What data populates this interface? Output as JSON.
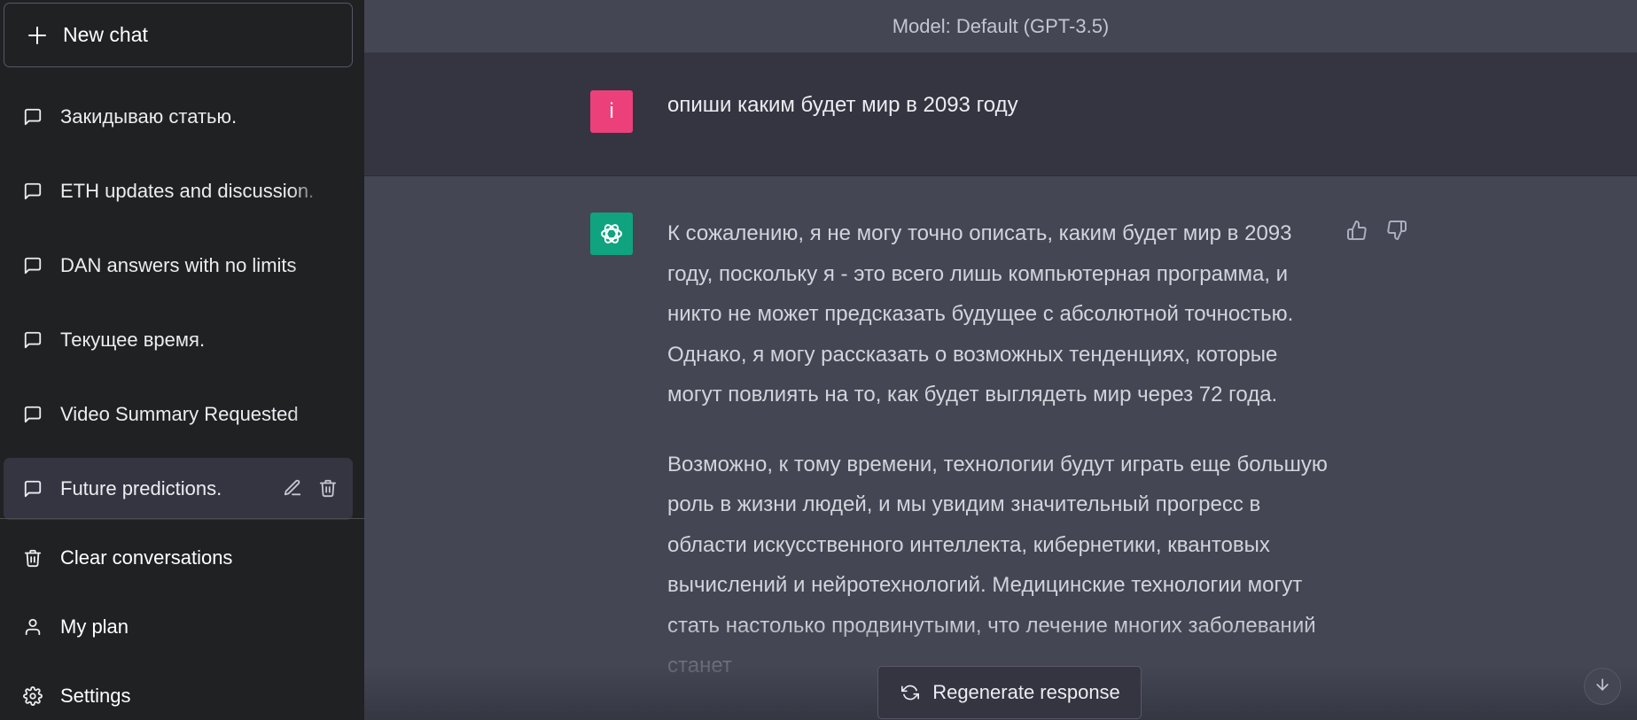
{
  "sidebar": {
    "new_chat_label": "New chat",
    "chats": [
      {
        "title": "Закидываю статью."
      },
      {
        "title": "ETH updates and discussion."
      },
      {
        "title": "DAN answers with no limits"
      },
      {
        "title": "Текущее время."
      },
      {
        "title": "Video Summary Requested"
      },
      {
        "title": "Future predictions."
      }
    ],
    "active_index": 5,
    "bottom": {
      "clear": "Clear conversations",
      "plan": "My plan",
      "settings": "Settings"
    }
  },
  "header": {
    "model_label": "Model: Default (GPT-3.5)"
  },
  "conversation": {
    "user_initial": "i",
    "user_message": "опиши каким будет мир в 2093 году",
    "assistant_paragraphs": [
      "К сожалению, я не могу точно описать, каким будет мир в 2093 году, поскольку я - это всего лишь компьютерная программа, и никто не может предсказать будущее с абсолютной точностью. Однако, я могу рассказать о возможных тенденциях, которые могут повлиять на то, как будет выглядеть мир через 72 года.",
      "Возможно, к тому времени, технологии будут играть еще большую роль в жизни людей, и мы увидим значительный прогресс в области искусственного интеллекта, кибернетики, квантовых вычислений и нейротехнологий. Медицинские технологии могут стать настолько продвинутыми, что лечение многих заболеваний станет"
    ]
  },
  "footer": {
    "regenerate_label": "Regenerate response"
  },
  "colors": {
    "sidebar_bg": "#202123",
    "main_bg": "#444654",
    "user_row_bg": "#343541",
    "user_avatar": "#ec407a",
    "assistant_avatar": "#10a37f"
  }
}
